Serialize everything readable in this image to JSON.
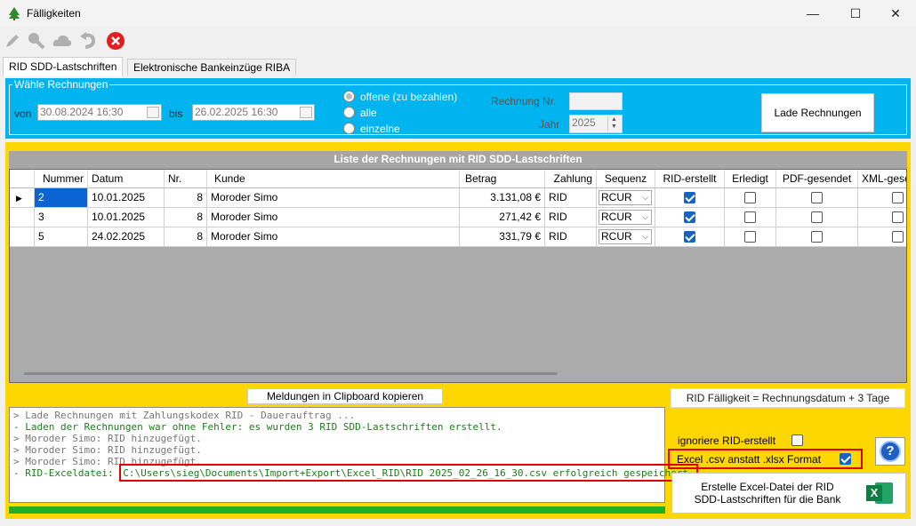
{
  "window": {
    "title": "Fälligkeiten",
    "controls": {
      "minimize": "—",
      "maximize": "☐",
      "close": "✕"
    }
  },
  "toolbar": {
    "icons": [
      "pencil-icon",
      "search-icon",
      "cloud-icon",
      "undo-icon",
      "close-red-icon"
    ]
  },
  "tabs": [
    {
      "label": "RID SDD-Lastschriften",
      "active": true
    },
    {
      "label": "Elektronische Bankeinzüge RIBA",
      "active": false
    }
  ],
  "filter": {
    "group_label": "Wähle Rechnungen",
    "from_label": "von",
    "from_value": "30.08.2024 16:30",
    "to_label": "bis",
    "to_value": "26.02.2025 16:30",
    "radios": [
      {
        "label": "offene (zu bezahlen)",
        "selected": true
      },
      {
        "label": "alle",
        "selected": false
      },
      {
        "label": "einzelne",
        "selected": false
      }
    ],
    "invoice_nr_label": "Rechnung Nr.",
    "invoice_nr_value": "",
    "year_label": "Jahr",
    "year_value": "2025",
    "load_button": "Lade Rechnungen"
  },
  "list": {
    "title": "Liste der Rechnungen mit RID SDD-Lastschriften",
    "columns": [
      "Nummer",
      "Datum",
      "Nr.",
      "Kunde",
      "Betrag",
      "Zahlung",
      "Sequenz",
      "RID-erstellt",
      "Erledigt",
      "PDF-gesendet",
      "XML-gese"
    ],
    "rows": [
      {
        "nummer": "2",
        "datum": "10.01.2025",
        "nr": "8",
        "kunde": "Moroder Simo",
        "betrag": "3.131,08 €",
        "zahlung": "RID",
        "sequenz": "RCUR",
        "rid_erstellt": true,
        "erledigt": false,
        "pdf_gesendet": false,
        "xml_gesendet": false
      },
      {
        "nummer": "3",
        "datum": "10.01.2025",
        "nr": "8",
        "kunde": "Moroder Simo",
        "betrag": "271,42 €",
        "zahlung": "RID",
        "sequenz": "RCUR",
        "rid_erstellt": true,
        "erledigt": false,
        "pdf_gesendet": false,
        "xml_gesendet": false
      },
      {
        "nummer": "5",
        "datum": "24.02.2025",
        "nr": "8",
        "kunde": "Moroder Simo",
        "betrag": "331,79 €",
        "zahlung": "RID",
        "sequenz": "RCUR",
        "rid_erstellt": true,
        "erledigt": false,
        "pdf_gesendet": false,
        "xml_gesendet": false
      }
    ]
  },
  "messages": {
    "copy_button": "Meldungen in Clipboard kopieren",
    "lines": [
      {
        "text": "> Lade Rechnungen mit Zahlungskodex RID - Dauerauftrag ...",
        "color": "gray"
      },
      {
        "text": "- Laden der Rechnungen war ohne Fehler: es wurden 3 RID SDD-Lastschriften erstellt.",
        "color": "green"
      },
      {
        "text": "> Moroder Simo: RID hinzugefügt.",
        "color": "gray"
      },
      {
        "text": "> Moroder Simo: RID hinzugefügt.",
        "color": "gray"
      },
      {
        "text": "> Moroder Simo: RID hinzugefügt.",
        "color": "gray"
      }
    ],
    "file_line_prefix": "- RID-Exceldatei: ",
    "file_line_path": "C:\\Users\\sieg\\Documents\\Import+Export\\Excel_RID\\RID 2025_02_26_16_30.csv erfolgreich gespeichert."
  },
  "right_panel": {
    "faelligkeit_info": "RID Fälligkeit = Rechnungsdatum + 3 Tage",
    "ignore_label": "ignoriere RID-erstellt",
    "ignore_checked": false,
    "csv_label": "Excel .csv anstatt .xlsx Format",
    "csv_checked": true,
    "help_icon": "?",
    "excel_button_line1": "Erstelle Excel-Datei der RID",
    "excel_button_line2": "SDD-Lastschriften für die Bank",
    "excel_icon_letter": "X"
  },
  "colors": {
    "accent_blue": "#00b4f0",
    "frame_yellow": "#ffd700",
    "progress_green": "#22b022",
    "highlight_red": "#e00000"
  }
}
